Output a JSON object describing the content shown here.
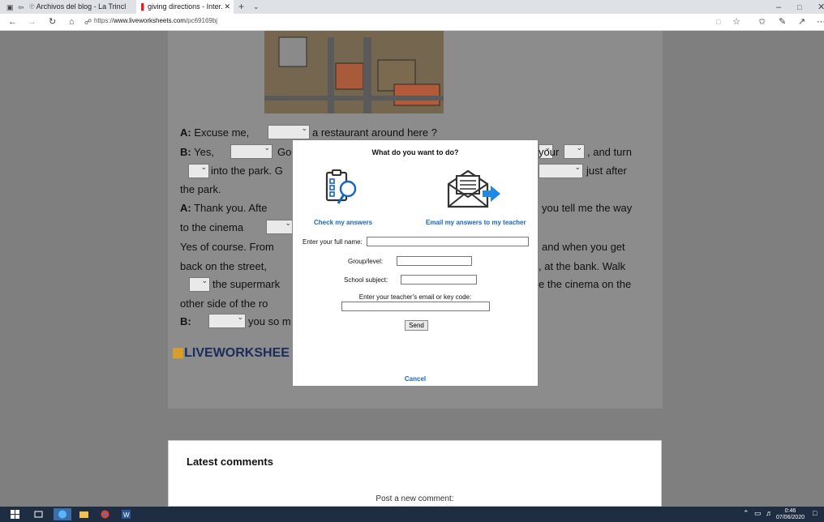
{
  "browser": {
    "tabs": [
      {
        "label": "Archivos del blog - La Trincl"
      },
      {
        "label": "giving directions - Inter."
      }
    ],
    "new_tab": "+",
    "url_prefix": "https://",
    "url_host": "www.liveworksheets.com",
    "url_path": "/pc69169bj"
  },
  "worksheet": {
    "lines": [
      {
        "speaker": "A:",
        "text": "Excuse me,",
        "rest": "a restaurant around here ?"
      },
      {
        "speaker": "B:",
        "text": "Yes,",
        "rest": "Go"
      },
      {
        "text": "into the park. G"
      },
      {
        "text": "the park."
      },
      {
        "speaker": "A:",
        "text": "Thank you. Afte"
      },
      {
        "text": "to the cinema"
      },
      {
        "text": "Yes of course. From"
      },
      {
        "text": "back on the street,"
      },
      {
        "text": "the supermark"
      },
      {
        "text": "other side of the ro"
      },
      {
        "speaker": "B:",
        "text": "you so m"
      }
    ],
    "right_lines": [
      "your",
      ", and turn",
      "just after",
      "you tell me the way",
      "and when you get",
      ", at the bank. Walk",
      "e the cinema on the"
    ],
    "logo": "LIVEWORKSHEE"
  },
  "modal": {
    "title": "What do you want to do?",
    "check_label": "Check my answers",
    "email_label": "Email my answers to my teacher",
    "full_name_label": "Enter your full name:",
    "group_label": "Group/level:",
    "subject_label": "School subject:",
    "teacher_label": "Enter your teacher's email or key code:",
    "send": "Send",
    "cancel": "Cancel"
  },
  "comments": {
    "title": "Latest comments",
    "post": "Post a new comment:"
  },
  "taskbar": {
    "time": "0:46",
    "date": "07/06/2020"
  },
  "colors": {
    "link": "#1665c1",
    "taskbar": "#1f2d43"
  }
}
